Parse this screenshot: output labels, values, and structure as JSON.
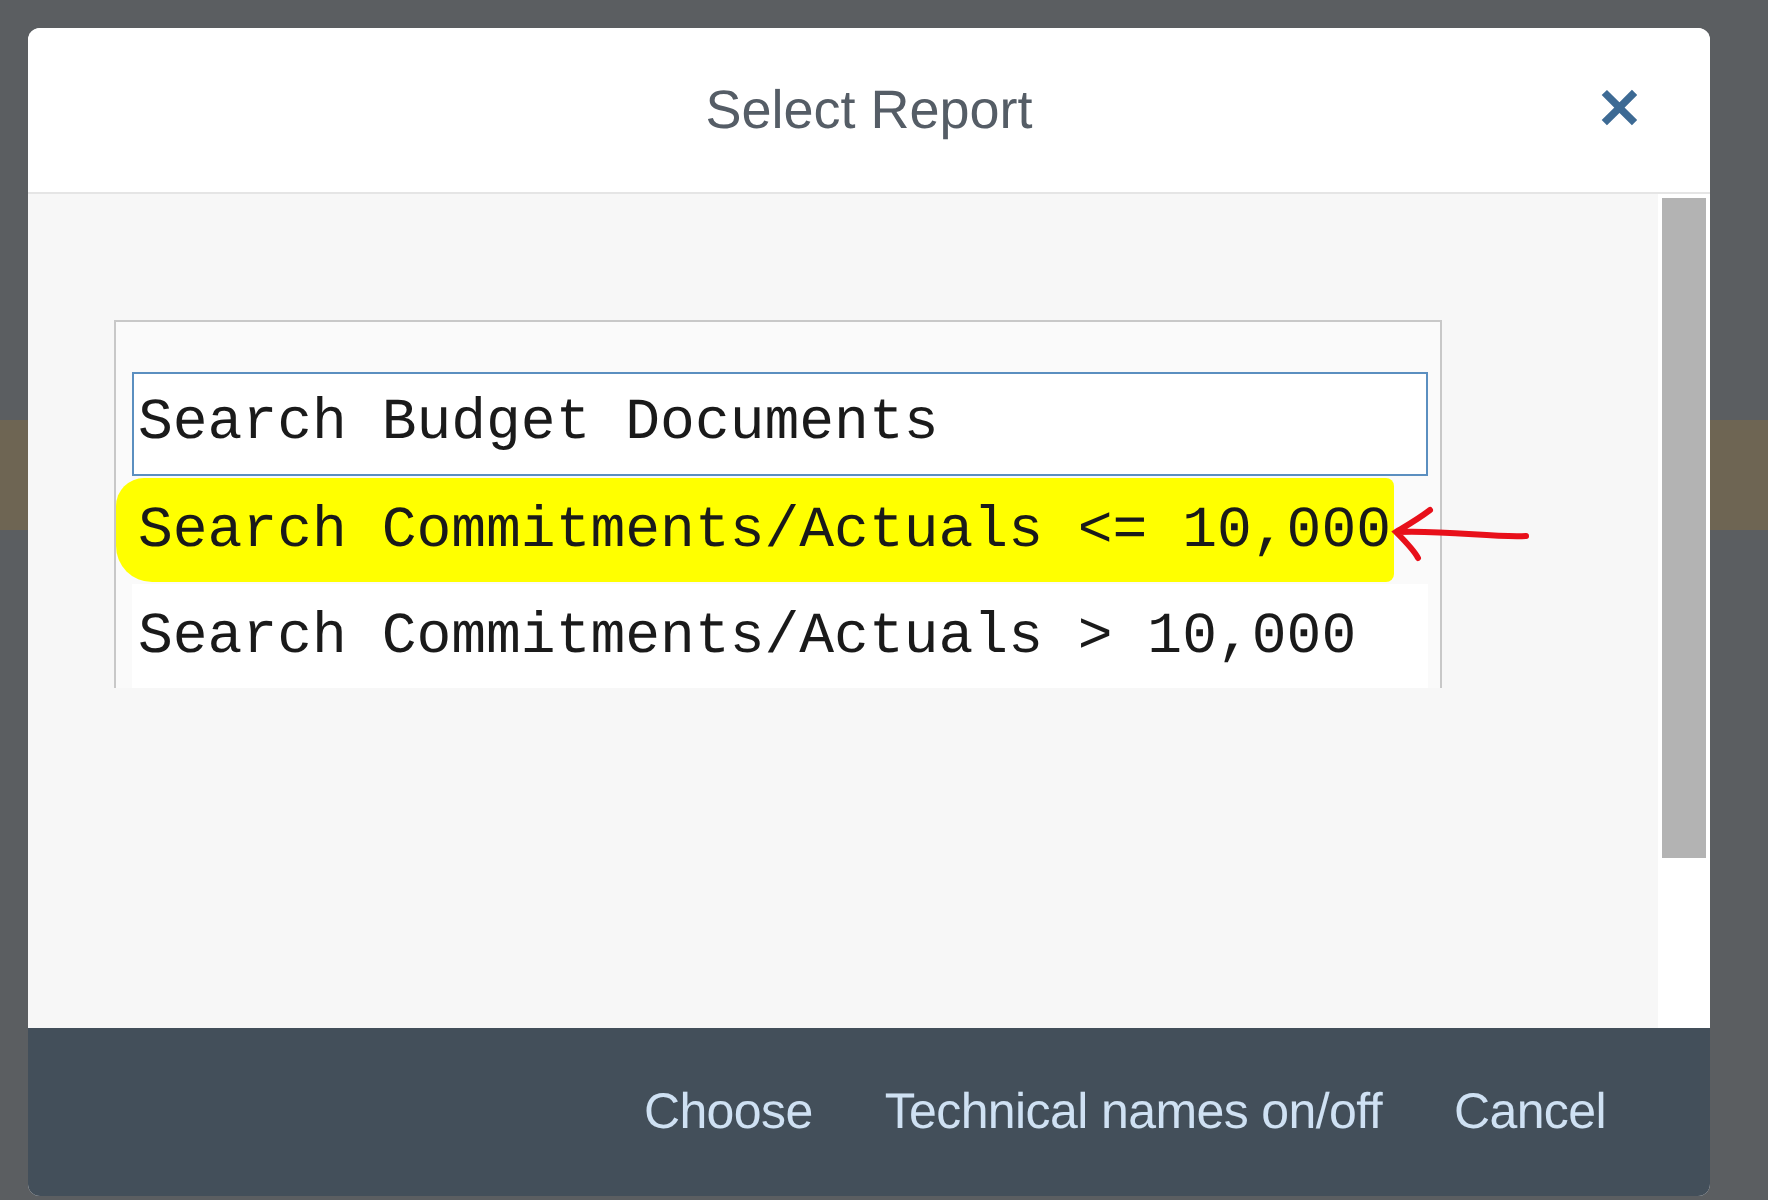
{
  "dialog": {
    "title": "Select Report",
    "close": "✕"
  },
  "reports": [
    {
      "label": "Search Budget Documents",
      "focused": true,
      "highlighted": false
    },
    {
      "label": "Search Commitments/Actuals <= 10,000",
      "focused": false,
      "highlighted": true
    },
    {
      "label": "Search Commitments/Actuals > 10,000",
      "focused": false,
      "highlighted": false
    }
  ],
  "buttons": [
    "Choose",
    "Technical names on/off",
    "Cancel"
  ]
}
